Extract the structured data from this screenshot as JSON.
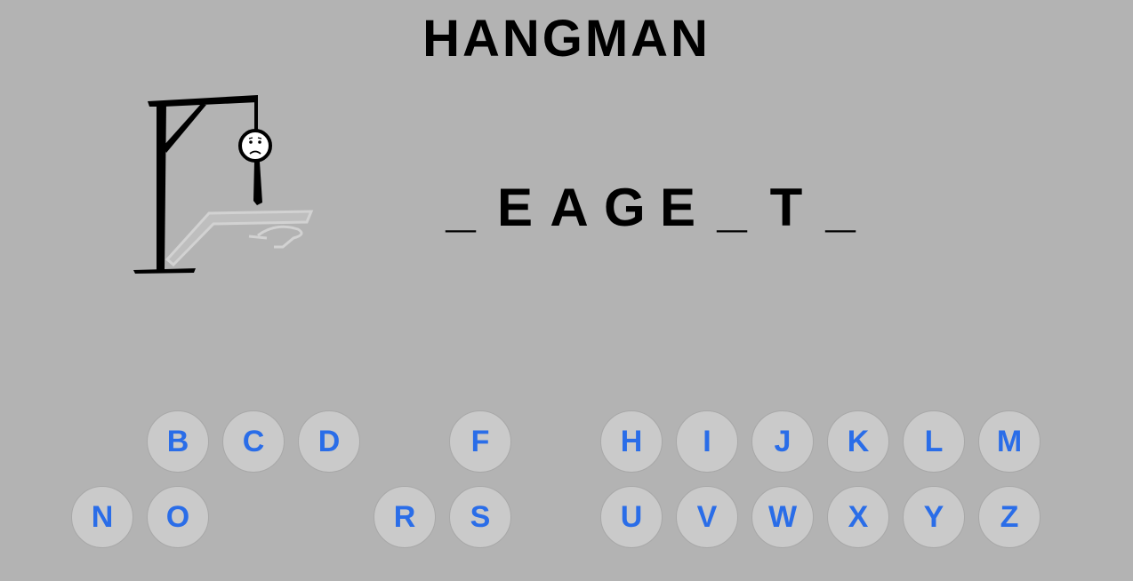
{
  "title": "HANGMAN",
  "word": [
    "_",
    "E",
    "A",
    "G",
    "E",
    "_",
    "T",
    "_"
  ],
  "keyboard": {
    "row1": [
      {
        "letter": "B",
        "col": 1
      },
      {
        "letter": "C",
        "col": 2
      },
      {
        "letter": "D",
        "col": 3
      },
      {
        "letter": "F",
        "col": 5
      },
      {
        "letter": "H",
        "col": 7
      },
      {
        "letter": "I",
        "col": 8
      },
      {
        "letter": "J",
        "col": 9
      },
      {
        "letter": "K",
        "col": 10
      },
      {
        "letter": "L",
        "col": 11
      },
      {
        "letter": "M",
        "col": 12
      }
    ],
    "row2": [
      {
        "letter": "N",
        "col": 0
      },
      {
        "letter": "O",
        "col": 1
      },
      {
        "letter": "R",
        "col": 4
      },
      {
        "letter": "S",
        "col": 5
      },
      {
        "letter": "U",
        "col": 7
      },
      {
        "letter": "V",
        "col": 8
      },
      {
        "letter": "W",
        "col": 9
      },
      {
        "letter": "X",
        "col": 10
      },
      {
        "letter": "Y",
        "col": 11
      },
      {
        "letter": "Z",
        "col": 12
      }
    ]
  },
  "colors": {
    "background": "#b3b3b3",
    "key_fill": "#cacaca",
    "key_text": "#2a6de8",
    "text": "#000000"
  }
}
